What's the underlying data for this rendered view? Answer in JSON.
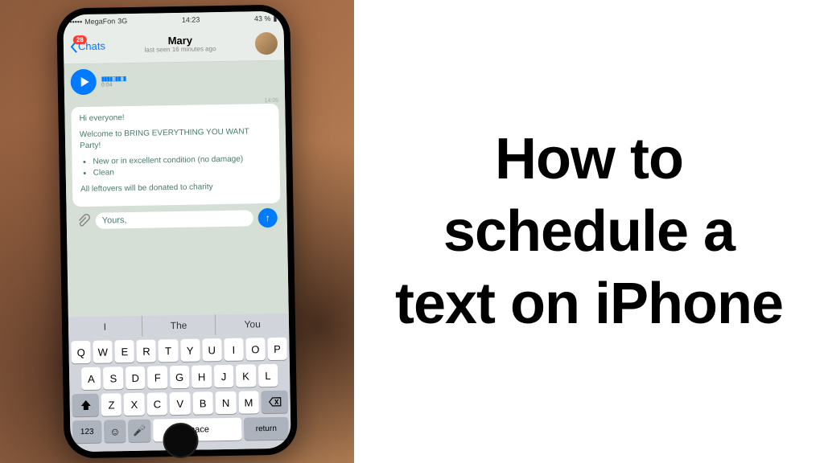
{
  "headline": "How to schedule a text on iPhone",
  "status": {
    "carrier": "MegaFon",
    "network": "3G",
    "time": "14:23",
    "battery": "43 %"
  },
  "header": {
    "back_label": "Chats",
    "badge_count": "28",
    "contact_name": "Mary",
    "last_seen": "last seen 16 minutes ago"
  },
  "voice": {
    "timestamp": "14:05",
    "duration": "0:04"
  },
  "message": {
    "greeting": "Hi everyone!",
    "intro": "Welcome to BRING EVERYTHING YOU WANT Party!",
    "bullet1": "New or in excellent condition (no damage)",
    "bullet2": "Clean",
    "footer": "All leftovers will be donated to charity"
  },
  "compose": {
    "text": "Yours,"
  },
  "suggestions": [
    "I",
    "The",
    "You"
  ],
  "keyboard": {
    "row1": [
      "Q",
      "W",
      "E",
      "R",
      "T",
      "Y",
      "U",
      "I",
      "O",
      "P"
    ],
    "row2": [
      "A",
      "S",
      "D",
      "F",
      "G",
      "H",
      "J",
      "K",
      "L"
    ],
    "row3": [
      "Z",
      "X",
      "C",
      "V",
      "B",
      "N",
      "M"
    ],
    "num_key": "123",
    "space": "space",
    "return": "return"
  }
}
